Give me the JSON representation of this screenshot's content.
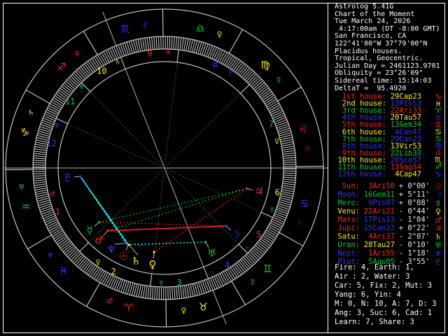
{
  "app": {
    "title": "Astrolog 5.41G"
  },
  "colors": {
    "red": "#ff2222",
    "yellow": "#ffee00",
    "green": "#00cc33",
    "blue": "#3333ff",
    "cyan": "#00ffff",
    "white": "#ffffff",
    "gray": "#999999",
    "line": "#e8e8e8"
  },
  "panel": {
    "header_lines": [
      "Astrolog 5.41G",
      "Chart of the Moment",
      "Tue March 24, 2026",
      " 4:17:00am (DT -8:00 GMT)",
      "San Francisco, CA",
      "122°41'00\"W 37°79'00\"N",
      "Placidus houses.",
      "Tropical, Geocentric.",
      "Julian Day = 2461123.9701",
      "Obliquity = 23°26'09\"",
      "Sidereal time: 15:14:03",
      "DeltaT =  95.4920"
    ],
    "houses": [
      {
        "label": "1st house:",
        "label_color": "red",
        "value": "29Cap23",
        "value_color": "yellow",
        "glyph": "♑",
        "glyph_color": "red"
      },
      {
        "label": "2nd house:",
        "label_color": "yellow",
        "value": "13Pis53",
        "value_color": "blue",
        "glyph": "♓",
        "glyph_color": "yellow"
      },
      {
        "label": "3rd house:",
        "label_color": "green",
        "value": "22Ari33",
        "value_color": "red",
        "glyph": "♈",
        "glyph_color": "green"
      },
      {
        "label": "4th house:",
        "label_color": "blue",
        "value": "20Tau57",
        "value_color": "yellow",
        "glyph": "♉",
        "glyph_color": "blue"
      },
      {
        "label": "5th house:",
        "label_color": "red",
        "value": "13Gem34",
        "value_color": "green",
        "glyph": "♊",
        "glyph_color": "red"
      },
      {
        "label": "6th house:",
        "label_color": "yellow",
        "value": "4Can47",
        "value_color": "blue",
        "glyph": "♋",
        "glyph_color": "yellow"
      },
      {
        "label": "7th house:",
        "label_color": "green",
        "value": "29Can23",
        "value_color": "blue",
        "glyph": "♋",
        "glyph_color": "green"
      },
      {
        "label": "8th house:",
        "label_color": "blue",
        "value": "13Vir53",
        "value_color": "yellow",
        "glyph": "♍",
        "glyph_color": "blue"
      },
      {
        "label": "9th house:",
        "label_color": "red",
        "value": "22Lib33",
        "value_color": "green",
        "glyph": "♎",
        "glyph_color": "red"
      },
      {
        "label": "10th house:",
        "label_color": "yellow",
        "value": "20Sco57",
        "value_color": "blue",
        "glyph": "♏",
        "glyph_color": "yellow"
      },
      {
        "label": "11th house:",
        "label_color": "green",
        "value": "13Sag34",
        "value_color": "red",
        "glyph": "♐",
        "glyph_color": "green"
      },
      {
        "label": "12th house:",
        "label_color": "blue",
        "value": "4Cap47",
        "value_color": "yellow",
        "glyph": "♑",
        "glyph_color": "blue"
      }
    ],
    "planets": [
      {
        "name": "Sun:",
        "name_color": "red",
        "value": "3Ari50",
        "value_color": "red",
        "vel": "+ 0°00'",
        "glyph": "☉",
        "glyph_color": "red"
      },
      {
        "name": "Moon:",
        "name_color": "blue",
        "value": "16Gem11",
        "value_color": "green",
        "vel": "+ 5°11'",
        "glyph": "☽",
        "glyph_color": "blue"
      },
      {
        "name": "Merc:",
        "name_color": "green",
        "value": "9Pis07",
        "value_color": "blue",
        "vel": "+ 0°08'",
        "glyph": "☿",
        "glyph_color": "green"
      },
      {
        "name": "Venu:",
        "name_color": "yellow",
        "value": "22Ari21",
        "value_color": "red",
        "vel": "- 0°44'",
        "glyph": "♀",
        "glyph_color": "yellow"
      },
      {
        "name": "Mars:",
        "name_color": "red",
        "value": "17Pis13",
        "value_color": "blue",
        "vel": "- 1°04'",
        "glyph": "♂",
        "glyph_color": "red"
      },
      {
        "name": "Jupi:",
        "name_color": "red",
        "value": "15Can22",
        "value_color": "blue",
        "vel": "+ 0°22'",
        "glyph": "♃",
        "glyph_color": "red"
      },
      {
        "name": "Satu:",
        "name_color": "yellow",
        "value": "4Ari37",
        "value_color": "red",
        "vel": "- 2°07'",
        "glyph": "♄",
        "glyph_color": "yellow"
      },
      {
        "name": "Uran:",
        "name_color": "green",
        "value": "28Tau27",
        "value_color": "yellow",
        "vel": "- 0°10'",
        "glyph": "♅",
        "glyph_color": "green"
      },
      {
        "name": "Nept:",
        "name_color": "blue",
        "value": "1Ari55",
        "value_color": "red",
        "vel": "- 1°18'",
        "glyph": "♆",
        "glyph_color": "blue"
      },
      {
        "name": "Plut:",
        "name_color": "blue",
        "value": "5Aqu05",
        "value_color": "green",
        "vel": "- 3°55'",
        "glyph": "♇",
        "glyph_color": "blue"
      }
    ],
    "stats_lines": [
      "Fire: 4, Earth: 1,",
      "Air : 2, Water: 3",
      "Car: 5, Fix: 2, Mut: 3",
      "Yang: 6, Yin: 4",
      "M: 0, N: 10, A: 7, D: 3",
      "Ang: 3, Suc: 6, Cad: 1",
      "Learn: 7, Share: 3"
    ]
  },
  "wheel": {
    "asc_lon": 299.383,
    "cusp_lons": [
      299.383,
      343.883,
      22.55,
      50.95,
      73.567,
      94.783,
      119.383,
      163.883,
      202.55,
      230.95,
      253.567,
      274.783
    ],
    "signs": [
      {
        "name": "Aries",
        "glyph": "♈",
        "color": "red",
        "ruler_glyph": "♂",
        "ruler_color": "red"
      },
      {
        "name": "Taurus",
        "glyph": "♉",
        "color": "yellow",
        "ruler_glyph": "♀",
        "ruler_color": "yellow"
      },
      {
        "name": "Gemini",
        "glyph": "♊",
        "color": "green",
        "ruler_glyph": "☿",
        "ruler_color": "green"
      },
      {
        "name": "Cancer",
        "glyph": "♋",
        "color": "blue",
        "ruler_glyph": "☽",
        "ruler_color": "blue"
      },
      {
        "name": "Leo",
        "glyph": "♌",
        "color": "red",
        "ruler_glyph": "☉",
        "ruler_color": "red"
      },
      {
        "name": "Virgo",
        "glyph": "♍",
        "color": "yellow",
        "ruler_glyph": "☿",
        "ruler_color": "green"
      },
      {
        "name": "Libra",
        "glyph": "♎",
        "color": "green",
        "ruler_glyph": "♀",
        "ruler_color": "yellow"
      },
      {
        "name": "Scorpio",
        "glyph": "♏",
        "color": "blue",
        "ruler_glyph": "♇",
        "ruler_color": "blue"
      },
      {
        "name": "Sagittarius",
        "glyph": "♐",
        "color": "red",
        "ruler_glyph": "♃",
        "ruler_color": "red"
      },
      {
        "name": "Capricorn",
        "glyph": "♑",
        "color": "yellow",
        "ruler_glyph": "♄",
        "ruler_color": "yellow"
      },
      {
        "name": "Aquarius",
        "glyph": "♒",
        "color": "green",
        "ruler_glyph": "♅",
        "ruler_color": "green"
      },
      {
        "name": "Pisces",
        "glyph": "♓",
        "color": "blue",
        "ruler_glyph": "♆",
        "ruler_color": "blue"
      }
    ],
    "house_ring": [
      {
        "num": "1",
        "color": "red",
        "ruler_glyph": "♂",
        "ruler_color": "red"
      },
      {
        "num": "2",
        "color": "yellow",
        "ruler_glyph": "♀",
        "ruler_color": "yellow"
      },
      {
        "num": "3",
        "color": "green",
        "ruler_glyph": "☿",
        "ruler_color": "green"
      },
      {
        "num": "4",
        "color": "blue",
        "ruler_glyph": "☽",
        "ruler_color": "blue"
      },
      {
        "num": "5",
        "color": "red",
        "ruler_glyph": "☉",
        "ruler_color": "red"
      },
      {
        "num": "6",
        "color": "yellow",
        "ruler_glyph": "☿",
        "ruler_color": "green"
      },
      {
        "num": "7",
        "color": "green",
        "ruler_glyph": "♀",
        "ruler_color": "yellow"
      },
      {
        "num": "8",
        "color": "blue",
        "ruler_glyph": "♇",
        "ruler_color": "blue"
      },
      {
        "num": "9",
        "color": "red",
        "ruler_glyph": "♃",
        "ruler_color": "red"
      },
      {
        "num": "10",
        "color": "yellow",
        "ruler_glyph": "♄",
        "ruler_color": "yellow"
      },
      {
        "num": "11",
        "color": "green",
        "ruler_glyph": "♅",
        "ruler_color": "green"
      },
      {
        "num": "12",
        "color": "blue",
        "ruler_glyph": "♆",
        "ruler_color": "blue"
      }
    ],
    "planets": [
      {
        "name": "sun",
        "glyph": "☉",
        "color": "red",
        "lon": 3.833,
        "display_lon": 4.5
      },
      {
        "name": "moon",
        "glyph": "☽",
        "color": "blue",
        "lon": 76.183,
        "display_lon": 76.183
      },
      {
        "name": "mercury",
        "glyph": "☿",
        "color": "green",
        "lon": 339.117,
        "display_lon": 339.117
      },
      {
        "name": "venus",
        "glyph": "♀",
        "color": "yellow",
        "lon": 22.35,
        "display_lon": 22.35
      },
      {
        "name": "mars",
        "glyph": "♂",
        "color": "red",
        "lon": 347.217,
        "display_lon": 347.217
      },
      {
        "name": "jupiter",
        "glyph": "♃",
        "color": "red",
        "lon": 105.367,
        "display_lon": 105.367
      },
      {
        "name": "saturn",
        "glyph": "♄",
        "color": "yellow",
        "lon": 4.617,
        "display_lon": 12.3
      },
      {
        "name": "uranus",
        "glyph": "♅",
        "color": "green",
        "lon": 58.45,
        "display_lon": 58.45
      },
      {
        "name": "neptune",
        "glyph": "♆",
        "color": "blue",
        "lon": 1.917,
        "display_lon": 356.3
      },
      {
        "name": "pluto",
        "glyph": "♇",
        "color": "blue",
        "lon": 305.083,
        "display_lon": 305.083
      }
    ],
    "aspects": [
      {
        "p1": "pluto",
        "p2": "sun",
        "color": "cyan",
        "style": "solid"
      },
      {
        "p1": "pluto",
        "p2": "saturn",
        "color": "cyan",
        "style": "dotted"
      },
      {
        "p1": "pluto",
        "p2": "neptune",
        "color": "cyan",
        "style": "dotted"
      },
      {
        "p1": "moon",
        "p2": "mars",
        "color": "red",
        "style": "solid"
      },
      {
        "p1": "moon",
        "p2": "mercury",
        "color": "red",
        "style": "dotted"
      },
      {
        "p1": "jupiter",
        "p2": "mars",
        "color": "green",
        "style": "dotted"
      },
      {
        "p1": "jupiter",
        "p2": "mercury",
        "color": "green",
        "style": "dotted"
      },
      {
        "p1": "uranus",
        "p2": "sun",
        "color": "cyan",
        "style": "dotted"
      },
      {
        "p1": "uranus",
        "p2": "saturn",
        "color": "cyan",
        "style": "dotted"
      },
      {
        "p1": "jupiter",
        "p2": "venus",
        "color": "red",
        "style": "dotted"
      },
      {
        "p1": "sun",
        "p2": "neptune",
        "color": "yellow",
        "style": "solid"
      },
      {
        "p1": "sun",
        "p2": "saturn",
        "color": "yellow",
        "style": "solid"
      }
    ]
  }
}
